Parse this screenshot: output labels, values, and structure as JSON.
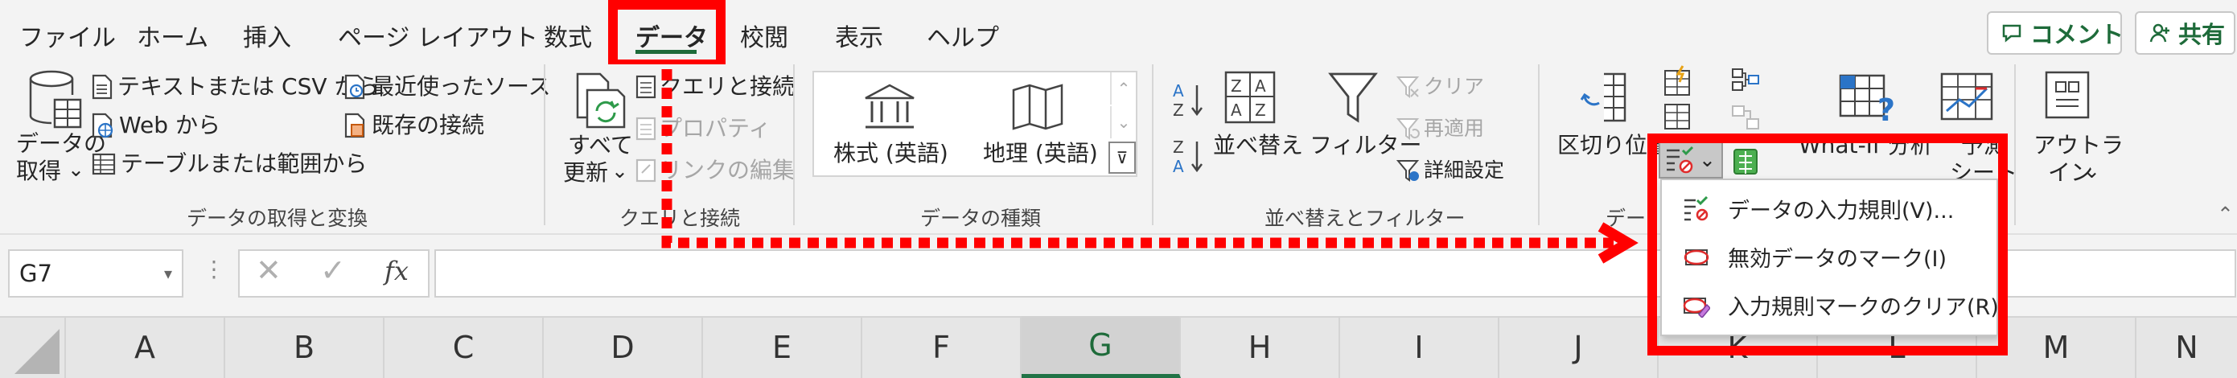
{
  "tabs": [
    "ファイル",
    "ホーム",
    "挿入",
    "ページ レイアウト",
    "数式",
    "データ",
    "校閲",
    "表示",
    "ヘルプ"
  ],
  "header_buttons": {
    "comment": "コメント",
    "share": "共有"
  },
  "group_get": {
    "label": "データの取得と変換",
    "get_data_line1": "データの",
    "get_data_line2": "取得",
    "text_csv": "テキストまたは CSV から",
    "web": "Web から",
    "table_range": "テーブルまたは範囲から",
    "recent_sources": "最近使ったソース",
    "existing_conn": "既存の接続"
  },
  "group_query": {
    "label": "クエリと接続",
    "refresh_line1": "すべて",
    "refresh_line2": "更新",
    "queries_conn": "クエリと接続",
    "properties": "プロパティ",
    "edit_links": "リンクの編集"
  },
  "group_types": {
    "label": "データの種類",
    "stocks": "株式 (英語)",
    "geography": "地理 (英語)"
  },
  "group_sort": {
    "label": "並べ替えとフィルター",
    "sort": "並べ替え",
    "filter": "フィルター",
    "clear": "クリア",
    "reapply": "再適用",
    "advanced": "詳細設定"
  },
  "group_tools": {
    "label_partial": "デー",
    "text_to_columns": "区切り位置"
  },
  "group_forecast": {
    "whatif": "What-If 分析",
    "forecast_line1": "予測",
    "forecast_line2": "シート"
  },
  "group_outline": {
    "line1": "アウトラ",
    "line2": "イン"
  },
  "dropdown_menu": {
    "items": [
      "データの入力規則(V)...",
      "無効データのマーク(I)",
      "入力規則マークのクリア(R)"
    ]
  },
  "formula_bar": {
    "name_box": "G7",
    "fx": "fx"
  },
  "columns": [
    "A",
    "B",
    "C",
    "D",
    "E",
    "F",
    "G",
    "H",
    "I",
    "J",
    "K",
    "L",
    "M",
    "N"
  ],
  "colors": {
    "highlight_red": "#ff0000",
    "accent_green": "#1e6b3a",
    "selected_col_bg": "#d2d2d2"
  }
}
